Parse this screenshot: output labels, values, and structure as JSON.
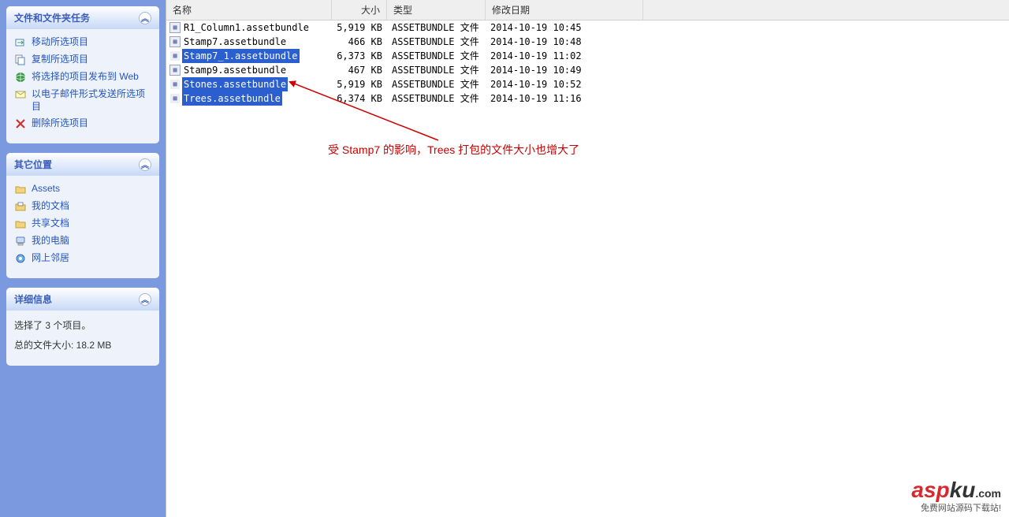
{
  "sidebar": {
    "panels": {
      "tasks": {
        "title": "文件和文件夹任务",
        "items": [
          {
            "icon": "move-icon",
            "label": "移动所选项目"
          },
          {
            "icon": "copy-icon",
            "label": "复制所选项目"
          },
          {
            "icon": "publish-icon",
            "label": "将选择的项目发布到 Web"
          },
          {
            "icon": "email-icon",
            "label": "以电子邮件形式发送所选项目"
          },
          {
            "icon": "delete-icon",
            "label": "删除所选项目"
          }
        ]
      },
      "places": {
        "title": "其它位置",
        "items": [
          {
            "icon": "folder-icon",
            "label": "Assets"
          },
          {
            "icon": "mydocs-icon",
            "label": "我的文档"
          },
          {
            "icon": "shared-icon",
            "label": "共享文档"
          },
          {
            "icon": "computer-icon",
            "label": "我的电脑"
          },
          {
            "icon": "network-icon",
            "label": "网上邻居"
          }
        ]
      },
      "details": {
        "title": "详细信息",
        "line1": "选择了 3 个项目。",
        "line2": "总的文件大小: 18.2 MB"
      }
    }
  },
  "columns": {
    "name": "名称",
    "size": "大小",
    "type": "类型",
    "date": "修改日期"
  },
  "files": [
    {
      "name": "R1_Column1.assetbundle",
      "size": "5,919 KB",
      "type": "ASSETBUNDLE 文件",
      "date": "2014-10-19 10:45",
      "selected": false
    },
    {
      "name": "Stamp7.assetbundle",
      "size": "466 KB",
      "type": "ASSETBUNDLE 文件",
      "date": "2014-10-19 10:48",
      "selected": false
    },
    {
      "name": "Stamp7_1.assetbundle",
      "size": "6,373 KB",
      "type": "ASSETBUNDLE 文件",
      "date": "2014-10-19 11:02",
      "selected": true
    },
    {
      "name": "Stamp9.assetbundle",
      "size": "467 KB",
      "type": "ASSETBUNDLE 文件",
      "date": "2014-10-19 10:49",
      "selected": false
    },
    {
      "name": "Stones.assetbundle",
      "size": "5,919 KB",
      "type": "ASSETBUNDLE 文件",
      "date": "2014-10-19 10:52",
      "selected": true
    },
    {
      "name": "Trees.assetbundle",
      "size": "6,374 KB",
      "type": "ASSETBUNDLE 文件",
      "date": "2014-10-19 11:16",
      "selected": true
    }
  ],
  "annotation": "受 Stamp7 的影响，Trees 打包的文件大小也增大了",
  "watermark": {
    "brand_a": "asp",
    "brand_b": "ku",
    "tld": ".com",
    "tagline": "免费网站源码下载站!"
  }
}
